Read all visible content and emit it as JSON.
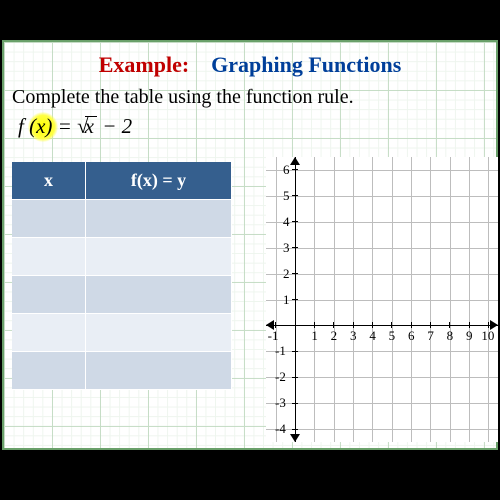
{
  "title": {
    "example_label": "Example:",
    "subject": "Graphing Functions"
  },
  "instruction": "Complete the table using the function rule.",
  "formula": {
    "lhs": "f (x)",
    "equals": " = ",
    "radicand": "x",
    "tail": " − 2"
  },
  "table": {
    "headers": {
      "x": "x",
      "y": "f(x) = y"
    },
    "rows": [
      {
        "x": "",
        "y": ""
      },
      {
        "x": "",
        "y": ""
      },
      {
        "x": "",
        "y": ""
      },
      {
        "x": "",
        "y": ""
      },
      {
        "x": "",
        "y": ""
      }
    ]
  },
  "chart_data": {
    "type": "scatter",
    "title": "",
    "xlabel": "",
    "ylabel": "",
    "x_ticks": [
      -1,
      1,
      2,
      3,
      4,
      5,
      6,
      7,
      8,
      9,
      10
    ],
    "y_ticks": [
      6,
      5,
      4,
      3,
      2,
      1,
      -1,
      -2,
      -3,
      -4
    ],
    "xlim": [
      -1.5,
      10.5
    ],
    "ylim": [
      -4.5,
      6.5
    ],
    "series": [],
    "grid": true,
    "neg1_label": "-1",
    "neg_dot": "-"
  }
}
